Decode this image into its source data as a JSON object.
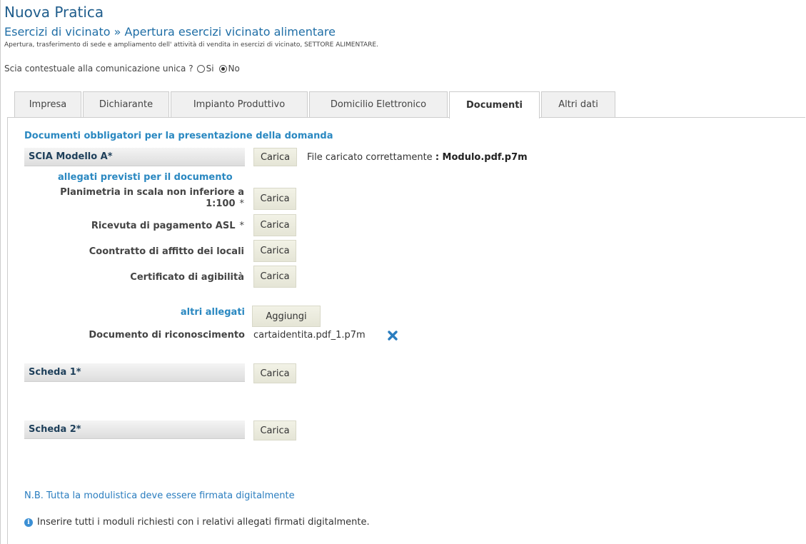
{
  "header": {
    "title": "Nuova Pratica",
    "subtitle": "Esercizi di vicinato » Apertura esercizi vicinato alimentare",
    "description": "Apertura, trasferimento di sede e ampliamento dell' attività di vendita in esercizi di vicinato, SETTORE ALIMENTARE."
  },
  "scia": {
    "question": "Scia contestuale alla comunicazione unica ?",
    "options": [
      "Si",
      "No"
    ],
    "selected": "No"
  },
  "tabs": [
    {
      "label": "Impresa",
      "active": false
    },
    {
      "label": "Dichiarante",
      "active": false
    },
    {
      "label": "Impianto Produttivo",
      "active": false
    },
    {
      "label": "Domicilio Elettronico",
      "active": false
    },
    {
      "label": "Documenti",
      "active": true
    },
    {
      "label": "Altri dati",
      "active": false
    }
  ],
  "documents": {
    "heading": "Documenti obbligatori per la presentazione della domanda",
    "main_doc": {
      "label": "SCIA Modello A*",
      "button": "Carica",
      "status_prefix": "File caricato correttamente",
      "status_file": ": Modulo.pdf.p7m"
    },
    "attachments_heading": "allegati previsti per il documento",
    "attachments": [
      {
        "label_line1": "Planimetria in scala non inferiore a",
        "label_line2": "1:100",
        "required": "*",
        "button": "Carica"
      },
      {
        "label": "Ricevuta di pagamento ASL",
        "required": "*",
        "button": "Carica"
      },
      {
        "label": "Coontratto di affitto dei locali",
        "button": "Carica"
      },
      {
        "label": "Certificato di agibilità",
        "button": "Carica"
      }
    ],
    "other_attachments": {
      "label": "altri allegati",
      "button": "Aggiungi",
      "items": [
        {
          "label": "Documento di riconoscimento",
          "file": "cartaidentita.pdf_1.p7m"
        }
      ]
    },
    "schede": [
      {
        "label": "Scheda 1*",
        "button": "Carica"
      },
      {
        "label": "Scheda 2*",
        "button": "Carica"
      }
    ],
    "note": "N.B. Tutta la modulistica deve essere firmata digitalmente",
    "info": "Inserire tutti i moduli richiesti con i relativi allegati firmati digitalmente."
  },
  "colors": {
    "title": "#1f5d8c",
    "heading_blue": "#2a88c1",
    "remove_icon": "#2a7dbf"
  },
  "icons": {
    "remove": "close-x-icon",
    "info": "info-icon"
  }
}
